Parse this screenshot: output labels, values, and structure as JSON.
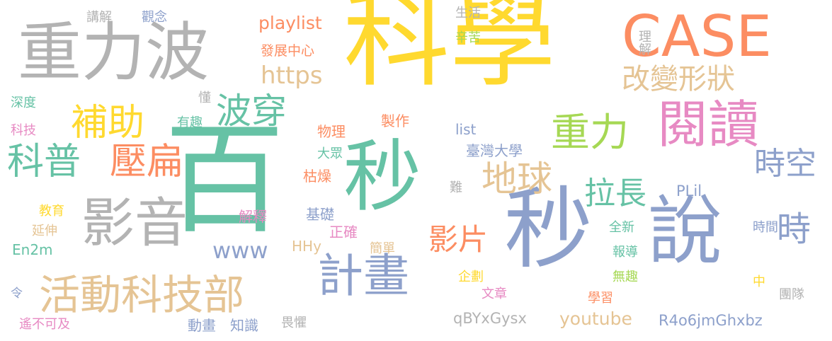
{
  "palette": {
    "yellow": "#ffd92f",
    "teal": "#66c2a5",
    "gray": "#b3b3b3",
    "orange": "#fc8d62",
    "blue": "#8da0cb",
    "pink": "#e78ac3",
    "green": "#a6d854",
    "tan": "#e5c494"
  },
  "words": [
    {
      "text": "科學",
      "color": "yellow",
      "weight": 100
    },
    {
      "text": "百",
      "color": "teal",
      "weight": 85
    },
    {
      "text": "秒",
      "color": "teal",
      "weight": 80
    },
    {
      "text": "秒",
      "color": "blue",
      "weight": 78
    },
    {
      "text": "說",
      "color": "blue",
      "weight": 72
    },
    {
      "text": "重力波",
      "color": "gray",
      "weight": 70
    },
    {
      "text": "CASE",
      "color": "orange",
      "weight": 60
    },
    {
      "text": "閱讀",
      "color": "pink",
      "weight": 58
    },
    {
      "text": "影音",
      "color": "gray",
      "weight": 56
    },
    {
      "text": "計畫",
      "color": "blue",
      "weight": 52
    },
    {
      "text": "活動科技部",
      "color": "tan",
      "weight": 48
    },
    {
      "text": "科普",
      "color": "teal",
      "weight": 45
    },
    {
      "text": "壓扁",
      "color": "orange",
      "weight": 45
    },
    {
      "text": "補助",
      "color": "yellow",
      "weight": 44
    },
    {
      "text": "重力",
      "color": "green",
      "weight": 44
    },
    {
      "text": "波穿",
      "color": "teal",
      "weight": 42
    },
    {
      "text": "地球",
      "color": "tan",
      "weight": 42
    },
    {
      "text": "拉長",
      "color": "teal",
      "weight": 38
    },
    {
      "text": "改變形狀",
      "color": "tan",
      "weight": 36
    },
    {
      "text": "時空",
      "color": "blue",
      "weight": 34
    },
    {
      "text": "時",
      "color": "blue",
      "weight": 34
    },
    {
      "text": "影片",
      "color": "orange",
      "weight": 34
    },
    {
      "text": "https",
      "color": "tan",
      "weight": 30
    },
    {
      "text": "www",
      "color": "blue",
      "weight": 28
    },
    {
      "text": "playlist",
      "color": "orange",
      "weight": 22
    },
    {
      "text": "youtube",
      "color": "tan",
      "weight": 22
    },
    {
      "text": "qBYxGysx",
      "color": "gray",
      "weight": 20
    },
    {
      "text": "R4o6jmGhxbz",
      "color": "blue",
      "weight": 20
    },
    {
      "text": "HHy",
      "color": "tan",
      "weight": 18
    },
    {
      "text": "list",
      "color": "blue",
      "weight": 18
    },
    {
      "text": "PLil",
      "color": "blue",
      "weight": 18
    },
    {
      "text": "En2m",
      "color": "teal",
      "weight": 18
    },
    {
      "text": "講解",
      "color": "gray",
      "weight": 14
    },
    {
      "text": "觀念",
      "color": "blue",
      "weight": 14
    },
    {
      "text": "生活",
      "color": "gray",
      "weight": 14
    },
    {
      "text": "辛苦",
      "color": "green",
      "weight": 14
    },
    {
      "text": "發展中心",
      "color": "orange",
      "weight": 16
    },
    {
      "text": "理解",
      "color": "gray",
      "weight": 14
    },
    {
      "text": "深度",
      "color": "teal",
      "weight": 14
    },
    {
      "text": "懂",
      "color": "gray",
      "weight": 14
    },
    {
      "text": "科技",
      "color": "pink",
      "weight": 14
    },
    {
      "text": "有趣",
      "color": "teal",
      "weight": 14
    },
    {
      "text": "物理",
      "color": "orange",
      "weight": 16
    },
    {
      "text": "製作",
      "color": "orange",
      "weight": 16
    },
    {
      "text": "大眾",
      "color": "teal",
      "weight": 14
    },
    {
      "text": "臺灣大學",
      "color": "blue",
      "weight": 16
    },
    {
      "text": "枯燥",
      "color": "orange",
      "weight": 16
    },
    {
      "text": "教育",
      "color": "yellow",
      "weight": 14
    },
    {
      "text": "延伸",
      "color": "tan",
      "weight": 14
    },
    {
      "text": "解釋",
      "color": "pink",
      "weight": 16
    },
    {
      "text": "基礎",
      "color": "blue",
      "weight": 16
    },
    {
      "text": "難",
      "color": "gray",
      "weight": 14
    },
    {
      "text": "正確",
      "color": "pink",
      "weight": 16
    },
    {
      "text": "全新",
      "color": "teal",
      "weight": 14
    },
    {
      "text": "時間",
      "color": "blue",
      "weight": 14
    },
    {
      "text": "簡單",
      "color": "tan",
      "weight": 14
    },
    {
      "text": "報導",
      "color": "teal",
      "weight": 14
    },
    {
      "text": "企劃",
      "color": "yellow",
      "weight": 14
    },
    {
      "text": "無趣",
      "color": "green",
      "weight": 14
    },
    {
      "text": "中",
      "color": "yellow",
      "weight": 14
    },
    {
      "text": "令",
      "color": "blue",
      "weight": 14
    },
    {
      "text": "文章",
      "color": "pink",
      "weight": 14
    },
    {
      "text": "學習",
      "color": "orange",
      "weight": 14
    },
    {
      "text": "團隊",
      "color": "gray",
      "weight": 14
    },
    {
      "text": "遙不可及",
      "color": "pink",
      "weight": 14
    },
    {
      "text": "動畫",
      "color": "blue",
      "weight": 16
    },
    {
      "text": "知識",
      "color": "blue",
      "weight": 16
    },
    {
      "text": "畏懼",
      "color": "gray",
      "weight": 14
    }
  ]
}
